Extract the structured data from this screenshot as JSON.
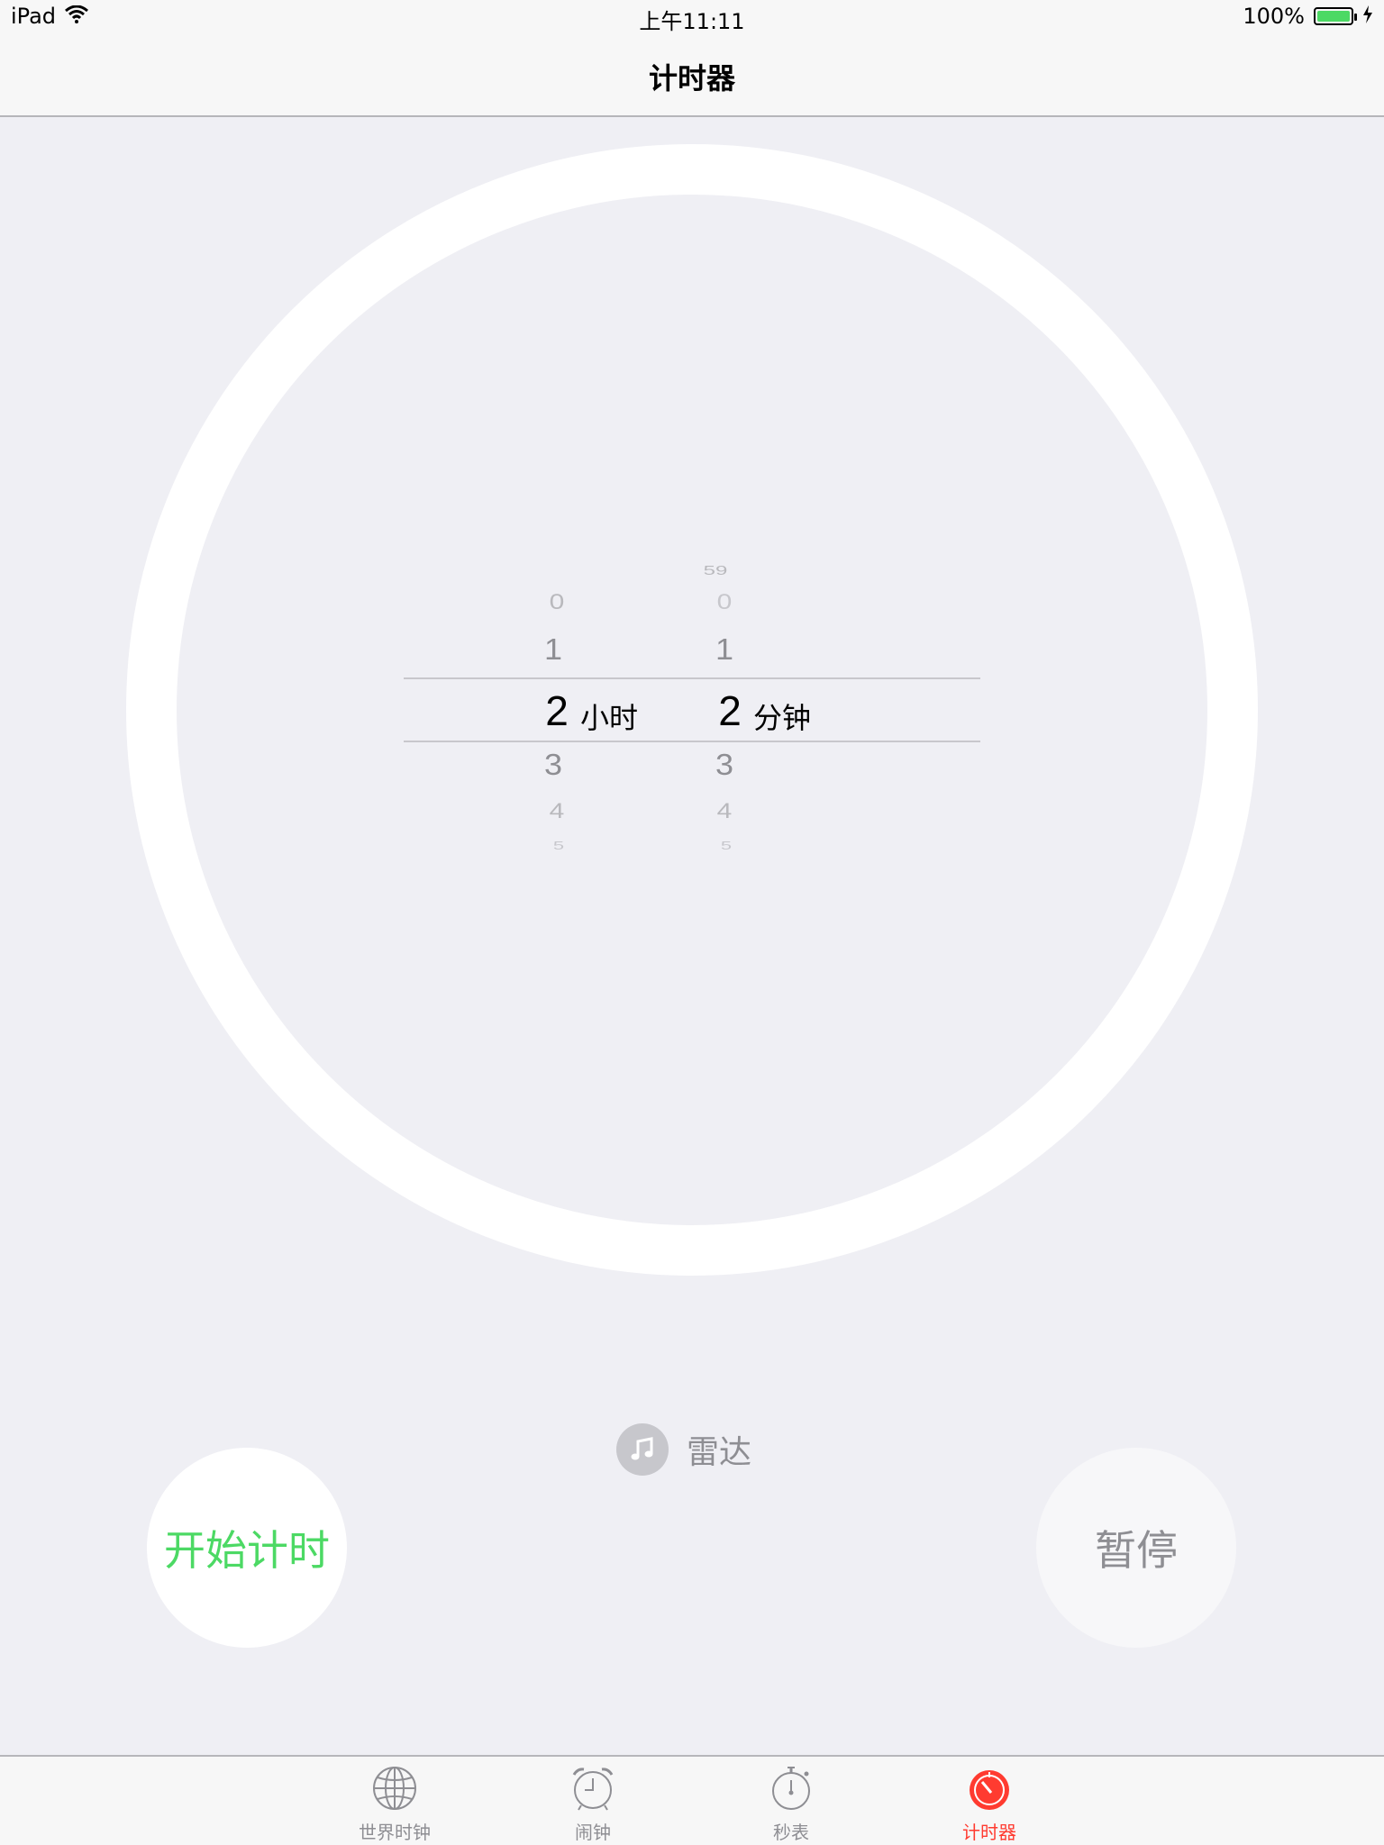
{
  "status_bar": {
    "device": "iPad",
    "time": "上午11:11",
    "battery": "100%",
    "battery_level": 1.0
  },
  "nav": {
    "title": "计时器"
  },
  "picker": {
    "hours": {
      "above": [
        "0",
        "1"
      ],
      "selected": "2",
      "below": [
        "3",
        "4",
        "5"
      ],
      "unit": "小时"
    },
    "minutes": {
      "above_far": "59",
      "above": [
        "0",
        "1"
      ],
      "selected": "2",
      "below": [
        "3",
        "4",
        "5"
      ],
      "unit": "分钟"
    }
  },
  "sound": {
    "icon": "music-note-icon",
    "label": "雷达"
  },
  "buttons": {
    "start": "开始计时",
    "pause": "暂停"
  },
  "tabs": [
    {
      "label": "世界时钟",
      "icon": "globe-icon"
    },
    {
      "label": "闹钟",
      "icon": "alarm-clock-icon"
    },
    {
      "label": "秒表",
      "icon": "stopwatch-icon"
    },
    {
      "label": "计时器",
      "icon": "timer-icon",
      "active": true
    }
  ],
  "colors": {
    "background": "#efeff4",
    "start_green": "#4cd964",
    "active_red": "#ff3b30",
    "inactive_gray": "#8e8e93"
  }
}
